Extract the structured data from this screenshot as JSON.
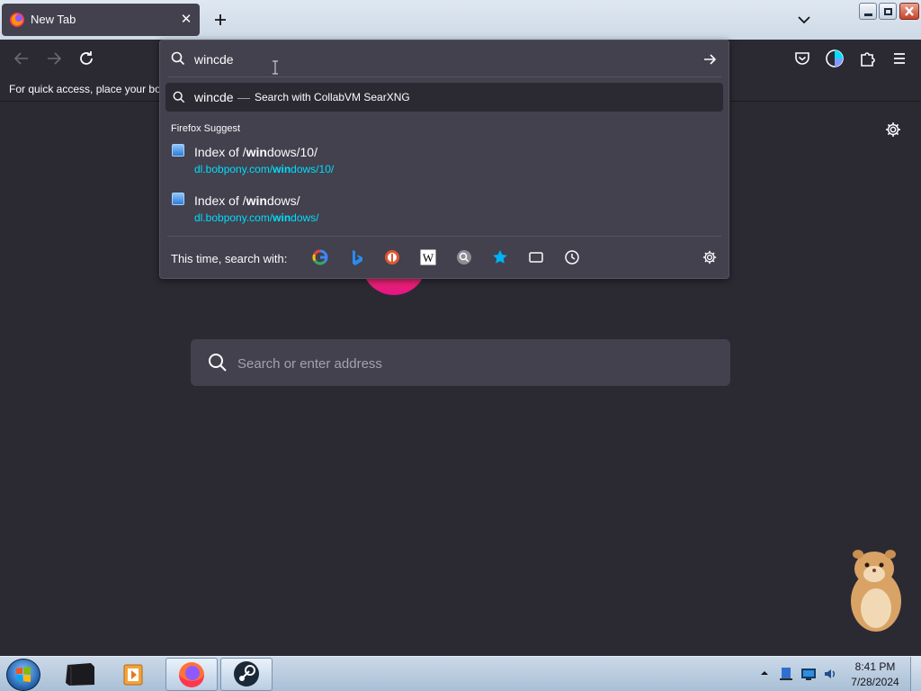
{
  "browser": {
    "tab": {
      "title": "New Tab",
      "favicon": "firefox-icon",
      "close_icon": "close-icon"
    },
    "new_tab_icon": "plus-icon",
    "list_all_tabs_icon": "chevron-down-icon",
    "window_controls": [
      "minimize-icon",
      "restore-icon",
      "close-icon"
    ]
  },
  "toolbar": {
    "back_icon": "arrow-left-icon",
    "forward_icon": "arrow-right-icon",
    "reload_icon": "reload-icon",
    "right_icons": [
      "pocket-icon",
      "account-icon",
      "extensions-icon",
      "menu-icon"
    ]
  },
  "bookmarks_bar": {
    "hint": "For quick access, place your boo"
  },
  "urlbar": {
    "value": "wincde",
    "go_icon": "arrow-right-icon",
    "search_suggestion": {
      "query": "wincde",
      "separator": "—",
      "action": "Search with CollabVM SearXNG"
    },
    "group_label": "Firefox Suggest",
    "results": [
      {
        "title_pre": "Index of /",
        "title_bold": "win",
        "title_post": "dows/10/",
        "url_pre": "dl.bobpony.com/",
        "url_bold": "win",
        "url_post": "dows/10/"
      },
      {
        "title_pre": "Index of /",
        "title_bold": "win",
        "title_post": "dows/",
        "url_pre": "dl.bobpony.com/",
        "url_bold": "win",
        "url_post": "dows/"
      }
    ],
    "one_off_label": "This time, search with:",
    "engines": [
      "google-icon",
      "bing-icon",
      "duckduckgo-icon",
      "wikipedia-icon",
      "searxng-icon",
      "bookmarks-star-icon",
      "tabs-icon",
      "history-clock-icon"
    ]
  },
  "newtab": {
    "search_placeholder": "Search or enter address",
    "settings_icon": "gear-icon"
  },
  "taskbar": {
    "start_icon": "windows-start-icon",
    "pinned": [
      "terminal-icon",
      "media-player-icon",
      "firefox-icon",
      "steam-icon"
    ],
    "tray_icons": [
      "show-hidden-icons",
      "network-icon",
      "display-icon",
      "volume-icon"
    ],
    "time": "8:41 PM",
    "date": "7/28/2024"
  },
  "colors": {
    "accent_url": "#00ddff",
    "panel": "#42414d",
    "background": "#2b2a33"
  }
}
